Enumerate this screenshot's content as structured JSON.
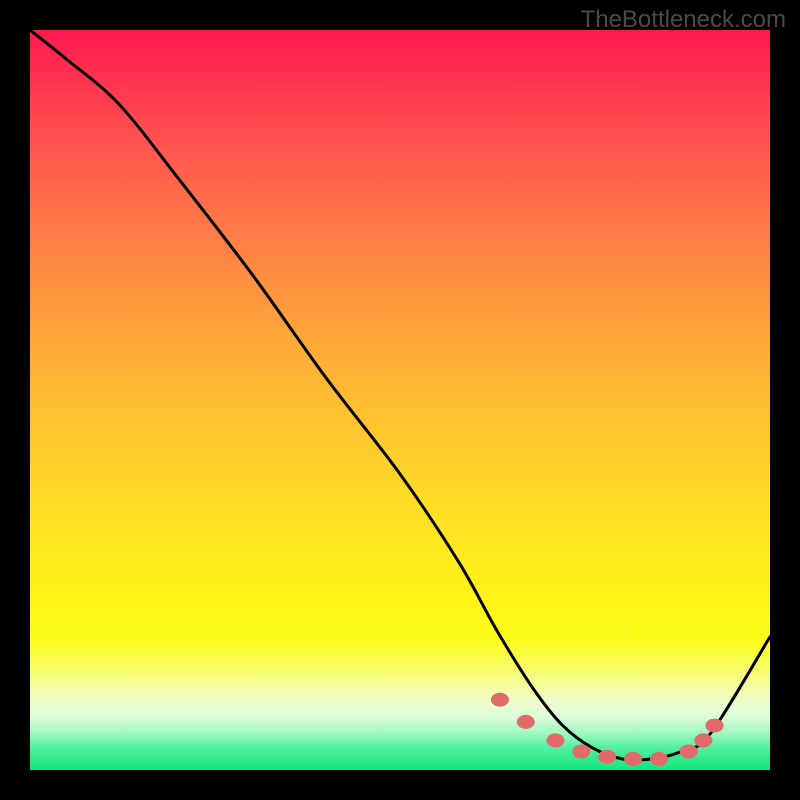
{
  "watermark": "TheBottleneck.com",
  "chart_data": {
    "type": "line",
    "title": "",
    "xlabel": "",
    "ylabel": "",
    "xlim": [
      0,
      100
    ],
    "ylim": [
      0,
      100
    ],
    "grid": false,
    "legend": false,
    "series": [
      {
        "name": "curve",
        "x": [
          0,
          5,
          12,
          20,
          30,
          40,
          50,
          58,
          63,
          68,
          72,
          76,
          80,
          84,
          88,
          92,
          100
        ],
        "y": [
          100,
          96,
          90,
          80,
          67,
          53,
          40,
          28,
          19,
          11,
          6,
          3,
          1.5,
          1.5,
          2.5,
          5,
          18
        ]
      }
    ],
    "markers": {
      "name": "highlight-points",
      "x": [
        63.5,
        67,
        71,
        74.5,
        78,
        81.5,
        85,
        89,
        91,
        92.5
      ],
      "y": [
        9.5,
        6.5,
        4,
        2.5,
        1.8,
        1.5,
        1.5,
        2.5,
        4,
        6
      ]
    },
    "colors": {
      "curve": "#000000",
      "markers": "#e26a6a",
      "gradient_top": "#ff1a4f",
      "gradient_bottom": "#12e47c"
    }
  }
}
